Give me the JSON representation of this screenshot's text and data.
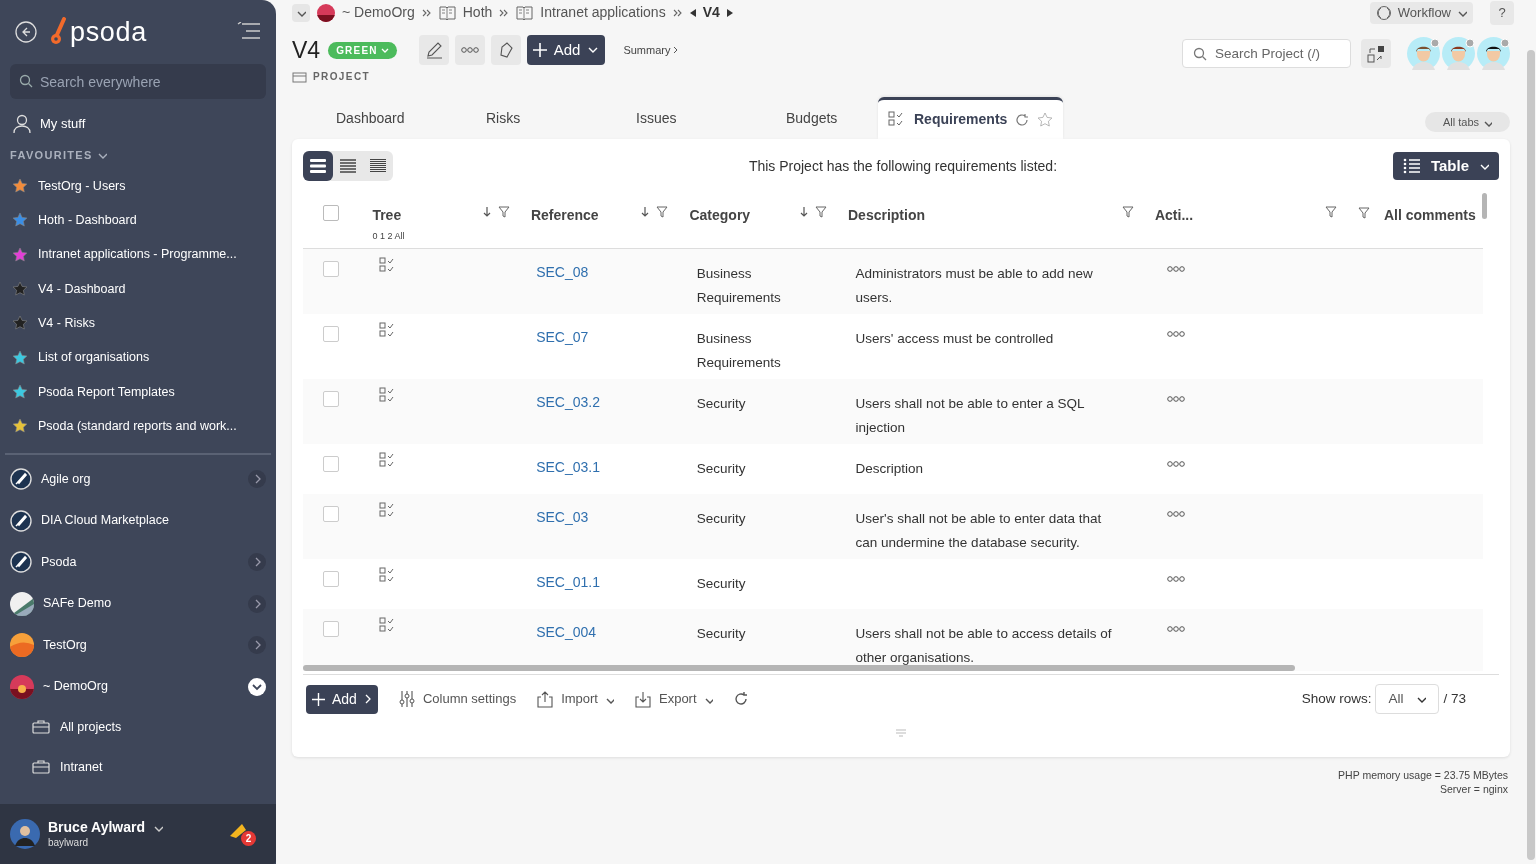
{
  "sidebar": {
    "logo": "psoda",
    "search": {
      "placeholder": "Search everywhere"
    },
    "my_stuff": "My stuff",
    "favourites_label": "FAVOURITES",
    "favourites": [
      {
        "label": "TestOrg - Users",
        "color": "#f28c3c"
      },
      {
        "label": "Hoth - Dashboard",
        "color": "#3a8ee6"
      },
      {
        "label": "Intranet applications - Programme...",
        "color": "#e23fd6"
      },
      {
        "label": "V4 - Dashboard",
        "color": "#222222"
      },
      {
        "label": "V4 - Risks",
        "color": "#222222"
      },
      {
        "label": "List of organisations",
        "color": "#3cc8e0"
      },
      {
        "label": "Psoda Report Templates",
        "color": "#3cc8e0"
      },
      {
        "label": "Psoda (standard reports and work...",
        "color": "#e6c23a"
      }
    ],
    "organisations": [
      {
        "name": "Agile org",
        "kind": "rocket",
        "has_children": true,
        "expanded": false
      },
      {
        "name": "DIA Cloud Marketplace",
        "kind": "rocket",
        "has_children": false,
        "expanded": false
      },
      {
        "name": "Psoda",
        "kind": "rocket",
        "has_children": true,
        "expanded": false
      },
      {
        "name": "SAFe Demo",
        "kind": "picture",
        "has_children": true,
        "expanded": false
      },
      {
        "name": "TestOrg",
        "kind": "picture",
        "has_children": true,
        "expanded": false
      },
      {
        "name": "~ DemoOrg",
        "kind": "picture",
        "has_children": true,
        "expanded": true,
        "children": [
          {
            "label": "All projects"
          },
          {
            "label": "Intranet"
          }
        ]
      }
    ],
    "user": {
      "name": "Bruce Aylward",
      "username": "baylward",
      "notifications": "2"
    }
  },
  "breadcrumb": [
    "~ DemoOrg",
    "Hoth",
    "Intranet applications",
    "V4"
  ],
  "workflow": "Workflow",
  "help": "?",
  "header": {
    "title": "V4",
    "status": "GREEN",
    "type": "PROJECT",
    "add": "Add",
    "summary": "Summary",
    "search": {
      "placeholder": "Search Project (/)"
    }
  },
  "tabs": [
    {
      "label": "Dashboard",
      "selected": false
    },
    {
      "label": "Risks",
      "selected": false
    },
    {
      "label": "Issues",
      "selected": false
    },
    {
      "label": "Budgets",
      "selected": false
    },
    {
      "label": "Requirements",
      "selected": true
    }
  ],
  "all_tabs": "All tabs",
  "density": [
    {
      "selected": true
    },
    {
      "selected": false
    },
    {
      "selected": false
    }
  ],
  "message": "This Project has the following requirements listed:",
  "view": "Table",
  "table": {
    "select_all": {
      "checked": false
    },
    "columns": [
      {
        "label": "Tree",
        "sub": "0 1 2 All"
      },
      {
        "label": "Reference"
      },
      {
        "label": "Category"
      },
      {
        "label": "Description"
      },
      {
        "label": "Acti..."
      },
      {
        "label": "All comments"
      }
    ],
    "rows": [
      {
        "checked": false,
        "reference": "SEC_08",
        "category": "Business Requirements",
        "description": "Administrators must be able to add new users."
      },
      {
        "checked": false,
        "reference": "SEC_07",
        "category": "Business Requirements",
        "description": "Users' access must be controlled"
      },
      {
        "checked": false,
        "reference": "SEC_03.2",
        "category": "Security",
        "description": "Users shall not be able to enter a SQL injection"
      },
      {
        "checked": false,
        "reference": "SEC_03.1",
        "category": "Security",
        "description": "Description"
      },
      {
        "checked": false,
        "reference": "SEC_03",
        "category": "Security",
        "description": "User's shall not be able to enter data that can undermine the database security."
      },
      {
        "checked": false,
        "reference": "SEC_01.1",
        "category": "Security",
        "description": ""
      },
      {
        "checked": false,
        "reference": "SEC_004",
        "category": "Security",
        "description": "Users shall not be able to access details of other organisations."
      }
    ]
  },
  "footer": {
    "add": "Add",
    "column_settings": "Column settings",
    "import": "Import",
    "export": "Export",
    "show_rows_label": "Show rows:",
    "show_rows": "All",
    "total": "/ 73"
  },
  "server_info": [
    "PHP memory usage = 23.75 MBytes",
    "Server = nginx"
  ]
}
